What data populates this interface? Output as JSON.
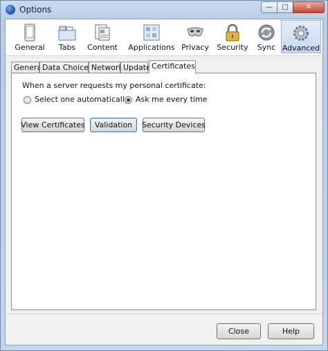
{
  "window": {
    "title": "Options"
  },
  "toolbar": {
    "panes": [
      {
        "label": "General",
        "icon": "general-icon"
      },
      {
        "label": "Tabs",
        "icon": "tabs-icon"
      },
      {
        "label": "Content",
        "icon": "content-icon"
      },
      {
        "label": "Applications",
        "icon": "applications-icon"
      },
      {
        "label": "Privacy",
        "icon": "privacy-mask-icon"
      },
      {
        "label": "Security",
        "icon": "padlock-icon"
      },
      {
        "label": "Sync",
        "icon": "sync-icon"
      },
      {
        "label": "Advanced",
        "icon": "gear-icon"
      }
    ],
    "selected": "Advanced"
  },
  "subtabs": {
    "items": [
      "General",
      "Data Choices",
      "Network",
      "Update",
      "Certificates"
    ],
    "active": "Certificates"
  },
  "certificates": {
    "prompt": "When a server requests my personal certificate:",
    "option_auto": "Select one automatically",
    "option_ask": "Ask me every time",
    "selected_option": "Ask me every time",
    "view_label": "View Certificates",
    "validation_label": "Validation",
    "devices_label": "Security Devices"
  },
  "footer": {
    "close_label": "Close",
    "help_label": "Help"
  },
  "colors": {
    "selected_pane": "#c6d8ee",
    "window_frame": "#b9cde6",
    "close_caption": "#c74631"
  }
}
